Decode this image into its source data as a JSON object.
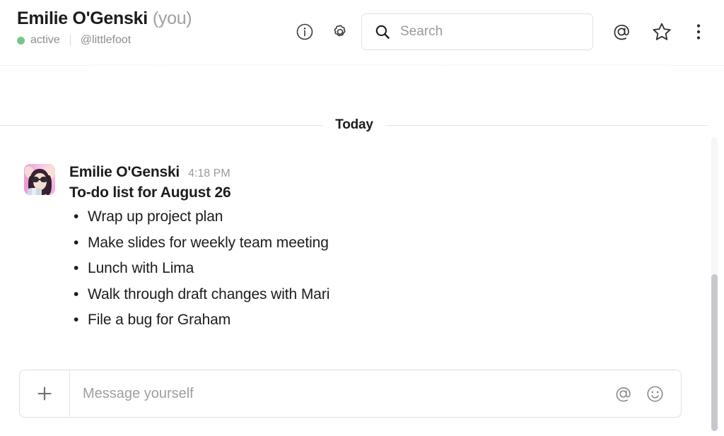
{
  "header": {
    "user_name": "Emilie O'Genski",
    "you_suffix": "(you)",
    "status_text": "active",
    "status_color": "#78c48a",
    "handle": "@littlefoot",
    "info_icon": "info-circle-icon",
    "gear_icon": "gear-icon",
    "at_icon": "at-mention-icon",
    "star_icon": "star-icon",
    "more_icon": "more-vertical-icon",
    "search": {
      "placeholder": "Search",
      "icon": "search-icon"
    }
  },
  "conversation": {
    "day_divider_label": "Today",
    "message": {
      "author": "Emilie O'Genski",
      "timestamp": "4:18 PM",
      "avatar_name": "user-avatar",
      "title": "To-do list for August 26",
      "todo_items": [
        "Wrap up project plan",
        "Make slides for weekly team meeting",
        "Lunch with Lima",
        "Walk through draft changes with Mari",
        "File a bug for Graham"
      ]
    }
  },
  "composer": {
    "placeholder": "Message yourself",
    "plus_icon": "plus-icon",
    "mention_icon": "at-mention-icon",
    "emoji_icon": "emoji-smiley-icon"
  },
  "colors": {
    "text_primary": "#1d1c1d",
    "text_muted": "#9b9a9c",
    "border": "#e2e1e3",
    "scrollbar_thumb": "#c9c7ce"
  }
}
